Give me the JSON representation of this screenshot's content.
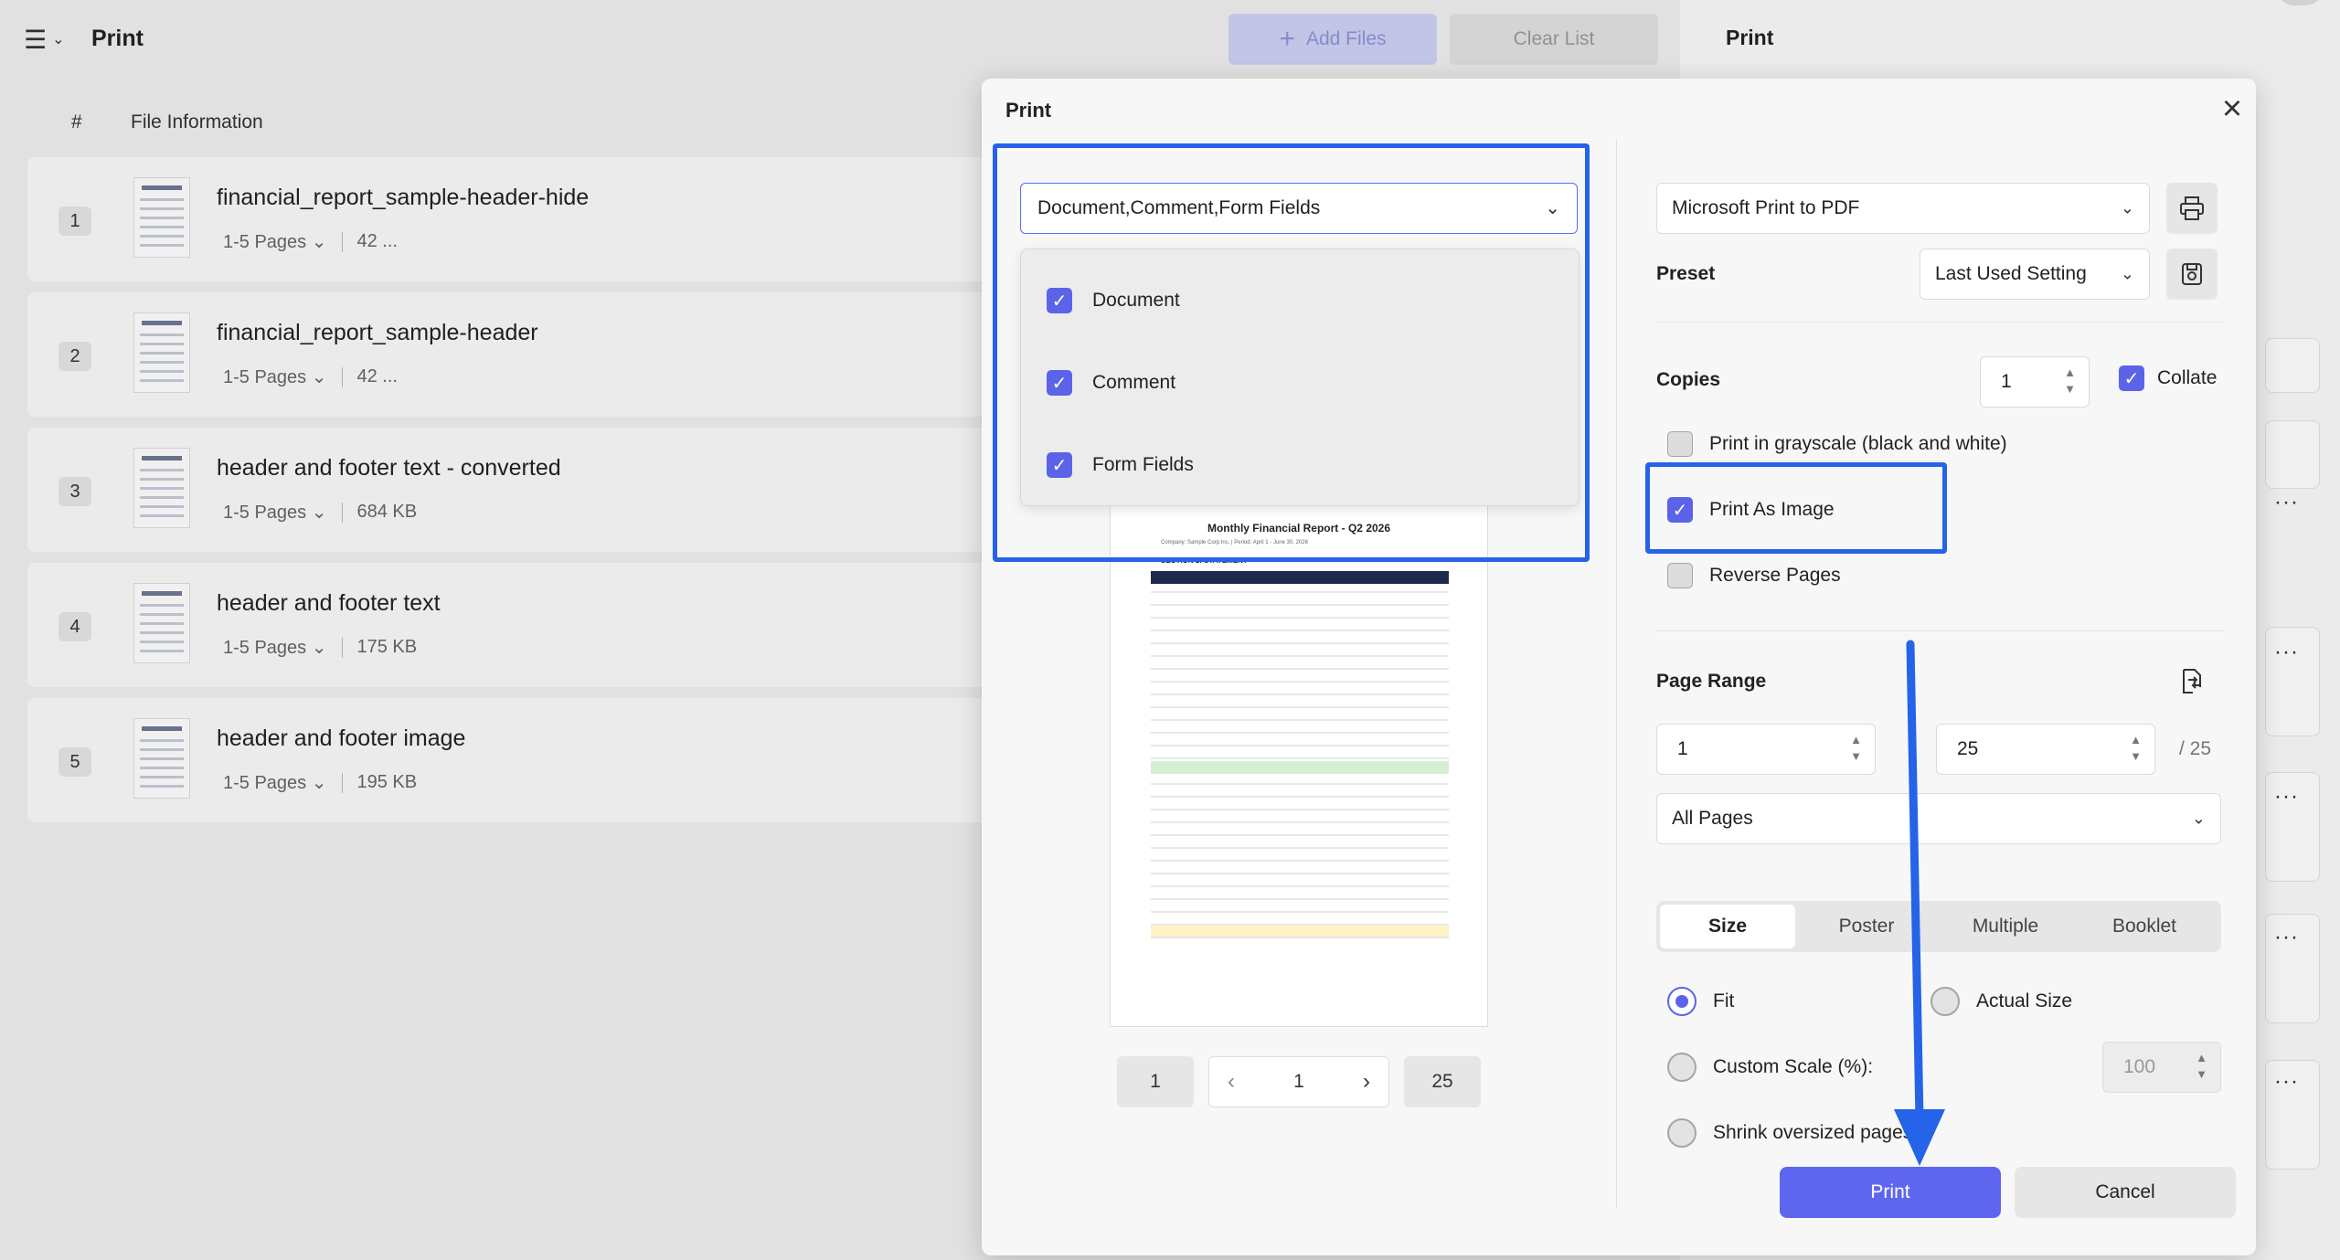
{
  "app": {
    "title": "Print",
    "add_files": "Add Files",
    "clear_list": "Clear List"
  },
  "list": {
    "col_index": "#",
    "col_info": "File Information",
    "files": [
      {
        "index": "1",
        "name": "financial_report_sample-header-hide",
        "pages": "1-5 Pages",
        "size": "42 ..."
      },
      {
        "index": "2",
        "name": "financial_report_sample-header",
        "pages": "1-5 Pages",
        "size": "42 ..."
      },
      {
        "index": "3",
        "name": "header and footer text - converted",
        "pages": "1-5 Pages",
        "size": "684 KB"
      },
      {
        "index": "4",
        "name": "header and footer text",
        "pages": "1-5 Pages",
        "size": "175 KB"
      },
      {
        "index": "5",
        "name": "header and footer image",
        "pages": "1-5 Pages",
        "size": "195 KB"
      }
    ]
  },
  "right_panel": {
    "title": "Print"
  },
  "dialog": {
    "title": "Print",
    "content_select": "Document,Comment,Form Fields",
    "content_options": [
      {
        "label": "Document",
        "checked": true
      },
      {
        "label": "Comment",
        "checked": true
      },
      {
        "label": "Form Fields",
        "checked": true
      }
    ],
    "preview": {
      "report_title": "Monthly Financial Report - Q2 2026",
      "report_subtitle": "Company: Sample Corp Inc. | Period: April 1 - June 30, 2026",
      "section": "SECTION 1: STATEMENT"
    },
    "pager": {
      "first": "1",
      "current": "1",
      "last": "25"
    },
    "printer": "Microsoft Print to PDF",
    "preset_label": "Preset",
    "preset_value": "Last Used Setting",
    "copies_label": "Copies",
    "copies_value": "1",
    "collate_label": "Collate",
    "collate_checked": true,
    "grayscale_label": "Print in grayscale (black and white)",
    "grayscale_checked": false,
    "print_as_image_label": "Print As Image",
    "print_as_image_checked": true,
    "reverse_label": "Reverse Pages",
    "reverse_checked": false,
    "page_range_label": "Page Range",
    "range_from": "1",
    "range_to": "25",
    "range_total": "/ 25",
    "range_mode": "All Pages",
    "size_tabs": [
      "Size",
      "Poster",
      "Multiple",
      "Booklet"
    ],
    "active_tab": "Size",
    "fit_label": "Fit",
    "actual_size_label": "Actual Size",
    "custom_scale_label": "Custom Scale (%):",
    "custom_scale_value": "100",
    "shrink_label": "Shrink oversized pages",
    "print_button": "Print",
    "cancel_button": "Cancel"
  },
  "colors": {
    "accent": "#5b63e8",
    "highlight": "#2563e8"
  }
}
